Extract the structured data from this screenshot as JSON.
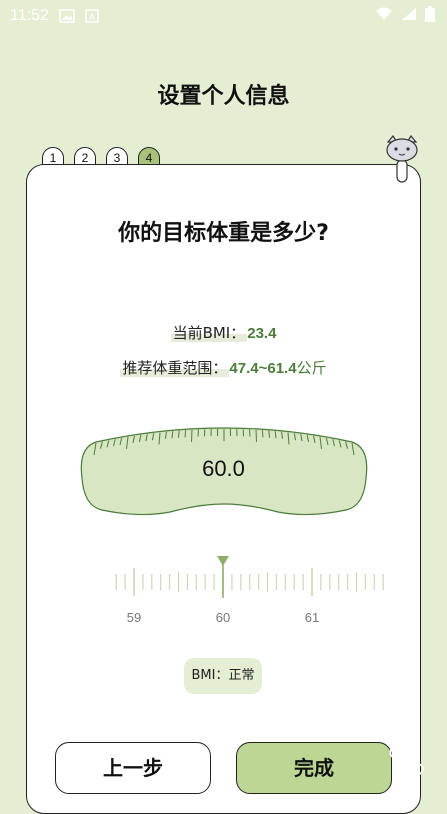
{
  "status_bar": {
    "time": "11:52",
    "left_icons": [
      "image-icon",
      "a-box-icon"
    ],
    "right_icons": [
      "wifi-icon",
      "signal-icon",
      "battery-icon"
    ]
  },
  "header": {
    "title": "设置个人信息"
  },
  "steps": [
    "1",
    "2",
    "3",
    "4"
  ],
  "active_step": "4",
  "question": "你的目标体重是多少?",
  "bmi": {
    "label": "当前BMI：",
    "value": "23.4"
  },
  "range": {
    "label": "推荐体重范围：",
    "value": "47.4~61.4",
    "unit": "公斤"
  },
  "scale": {
    "value": "60.0"
  },
  "ruler": {
    "labels": [
      "59",
      "60",
      "61"
    ],
    "selected": 60.0
  },
  "bmi_status": "BMI：正常",
  "buttons": {
    "prev": "上一步",
    "done": "完成"
  },
  "colors": {
    "background": "#e4eed3",
    "accent": "#a7c27a",
    "value_green": "#4a7c3a",
    "done_button": "#bcd694"
  }
}
